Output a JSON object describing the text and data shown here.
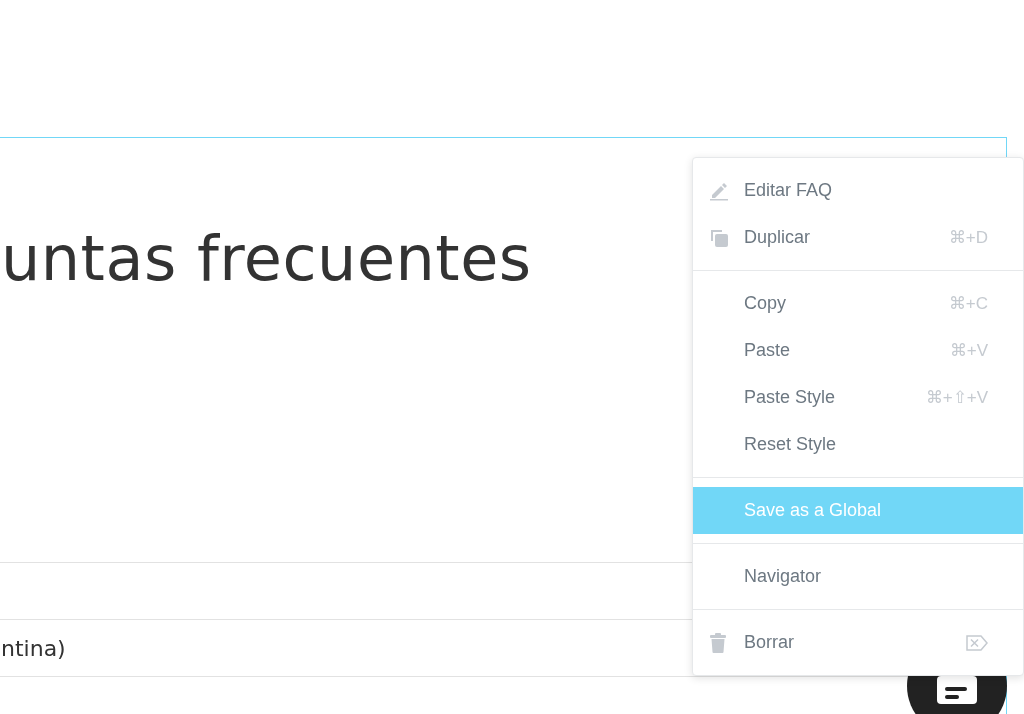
{
  "heading": "untas frecuentes",
  "rows": [
    "ntina)"
  ],
  "menu": {
    "groups": [
      {
        "items": [
          {
            "kind": "edit",
            "label": "Editar FAQ",
            "selected": false
          },
          {
            "kind": "duplicate",
            "label": "Duplicar",
            "shortcut": "⌘+D",
            "selected": false
          }
        ]
      },
      {
        "items": [
          {
            "kind": "plain",
            "label": "Copy",
            "shortcut": "⌘+C",
            "selected": false
          },
          {
            "kind": "plain",
            "label": "Paste",
            "shortcut": "⌘+V",
            "selected": false
          },
          {
            "kind": "plain",
            "label": "Paste Style",
            "shortcut": "⌘+⇧+V",
            "selected": false
          },
          {
            "kind": "plain",
            "label": "Reset Style",
            "selected": false
          }
        ]
      },
      {
        "items": [
          {
            "kind": "plain",
            "label": "Save as a Global",
            "selected": true
          }
        ]
      },
      {
        "items": [
          {
            "kind": "plain",
            "label": "Navigator",
            "selected": false
          }
        ]
      },
      {
        "items": [
          {
            "kind": "delete",
            "label": "Borrar",
            "selected": false
          }
        ]
      }
    ]
  }
}
